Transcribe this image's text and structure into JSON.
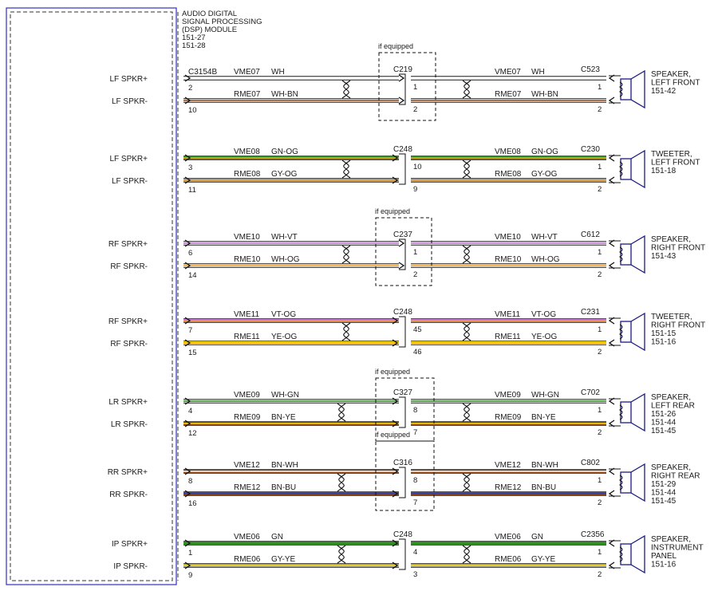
{
  "module": {
    "title_lines": [
      "AUDIO DIGITAL",
      "SIGNAL PROCESSING",
      "(DSP) MODULE",
      "151-27",
      "151-28"
    ],
    "connector": "C3154B"
  },
  "optional_label": "if equipped",
  "colors": {
    "WH": "#ffffff",
    "BN": "#8b4513",
    "GN": "#2f8f1f",
    "OG": "#f4a020",
    "GY": "#9a9a9a",
    "VT": "#c070d0",
    "YE": "#ffe000",
    "BU": "#1f3fd0",
    "RD": "#d03030",
    "module_border": "#3030c0",
    "speaker": "#1a1a80"
  },
  "circuits": [
    {
      "pos": {
        "label": "LF SPKR+",
        "pin": "2",
        "circuit": "VME07",
        "color": "WH",
        "stripe": [
          "WH"
        ],
        "mid_pin": "1",
        "spk_pin": "1"
      },
      "neg": {
        "label": "LF SPKR-",
        "pin": "10",
        "circuit": "RME07",
        "color": "WH-BN",
        "stripe": [
          "WH",
          "BN"
        ],
        "mid_pin": "2",
        "spk_pin": "2"
      },
      "inline": "C219",
      "optional": true,
      "plug_at_ramp": true,
      "dev_connector": "C523",
      "dev_lines": [
        "SPEAKER,",
        "LEFT FRONT",
        "151-42"
      ],
      "dev_type": "speaker"
    },
    {
      "pos": {
        "label": "LF SPKR+",
        "pin": "3",
        "circuit": "VME08",
        "color": "GN-OG",
        "stripe": [
          "GN",
          "OG"
        ],
        "mid_pin": "10",
        "spk_pin": "1"
      },
      "neg": {
        "label": "LF SPKR-",
        "pin": "11",
        "circuit": "RME08",
        "color": "GY-OG",
        "stripe": [
          "GY",
          "OG"
        ],
        "mid_pin": "9",
        "spk_pin": "2"
      },
      "inline": "C248",
      "optional": false,
      "plug_at_ramp": false,
      "dev_connector": "C230",
      "dev_lines": [
        "TWEETER,",
        "LEFT FRONT",
        "151-18"
      ],
      "dev_type": "tweeter"
    },
    {
      "pos": {
        "label": "RF SPKR+",
        "pin": "6",
        "circuit": "VME10",
        "color": "WH-VT",
        "stripe": [
          "WH",
          "VT"
        ],
        "mid_pin": "1",
        "spk_pin": "1"
      },
      "neg": {
        "label": "RF SPKR-",
        "pin": "14",
        "circuit": "RME10",
        "color": "WH-OG",
        "stripe": [
          "WH",
          "OG"
        ],
        "mid_pin": "2",
        "spk_pin": "2"
      },
      "inline": "C237",
      "optional": true,
      "plug_at_ramp": true,
      "dev_connector": "C612",
      "dev_lines": [
        "SPEAKER,",
        "RIGHT FRONT",
        "151-43"
      ],
      "dev_type": "speaker"
    },
    {
      "pos": {
        "label": "RF SPKR+",
        "pin": "7",
        "circuit": "VME11",
        "color": "VT-OG",
        "stripe": [
          "VT",
          "OG"
        ],
        "mid_pin": "45",
        "spk_pin": "1"
      },
      "neg": {
        "label": "RF SPKR-",
        "pin": "15",
        "circuit": "RME11",
        "color": "YE-OG",
        "stripe": [
          "YE",
          "OG"
        ],
        "mid_pin": "46",
        "spk_pin": "2"
      },
      "inline": "C248",
      "optional": false,
      "plug_at_ramp": false,
      "dev_connector": "C231",
      "dev_lines": [
        "TWEETER,",
        "RIGHT FRONT",
        "151-15",
        "151-16"
      ],
      "dev_type": "tweeter"
    },
    {
      "pos": {
        "label": "LR SPKR+",
        "pin": "4",
        "circuit": "VME09",
        "color": "WH-GN",
        "stripe": [
          "WH",
          "GN"
        ],
        "mid_pin": "8",
        "spk_pin": "1"
      },
      "neg": {
        "label": "LR SPKR-",
        "pin": "12",
        "circuit": "RME09",
        "color": "BN-YE",
        "stripe": [
          "BN",
          "YE"
        ],
        "mid_pin": "7",
        "spk_pin": "2"
      },
      "inline": "C327",
      "optional": true,
      "plug_at_ramp": false,
      "dev_connector": "C702",
      "dev_lines": [
        "SPEAKER,",
        "LEFT REAR",
        "151-26",
        "151-44",
        "151-45"
      ],
      "dev_type": "speaker"
    },
    {
      "pos": {
        "label": "RR SPKR+",
        "pin": "8",
        "circuit": "VME12",
        "color": "BN-WH",
        "stripe": [
          "BN",
          "WH"
        ],
        "mid_pin": "8",
        "spk_pin": "1"
      },
      "neg": {
        "label": "RR SPKR-",
        "pin": "16",
        "circuit": "RME12",
        "color": "BN-BU",
        "stripe": [
          "BN",
          "BU"
        ],
        "mid_pin": "7",
        "spk_pin": "2"
      },
      "inline": "C316",
      "optional": true,
      "plug_at_ramp": false,
      "dev_connector": "C802",
      "dev_lines": [
        "SPEAKER,",
        "RIGHT REAR",
        "151-29",
        "151-44",
        "151-45"
      ],
      "dev_type": "speaker"
    },
    {
      "pos": {
        "label": "IP SPKR+",
        "pin": "1",
        "circuit": "VME06",
        "color": "GN",
        "stripe": [
          "GN"
        ],
        "mid_pin": "4",
        "spk_pin": "1"
      },
      "neg": {
        "label": "IP SPKR-",
        "pin": "9",
        "circuit": "RME06",
        "color": "GY-YE",
        "stripe": [
          "GY",
          "YE"
        ],
        "mid_pin": "3",
        "spk_pin": "2"
      },
      "inline": "C248",
      "optional": false,
      "plug_at_ramp": false,
      "dev_connector": "C2356",
      "dev_lines": [
        "SPEAKER,",
        "INSTRUMENT",
        "PANEL",
        "151-16"
      ],
      "dev_type": "speaker"
    }
  ]
}
